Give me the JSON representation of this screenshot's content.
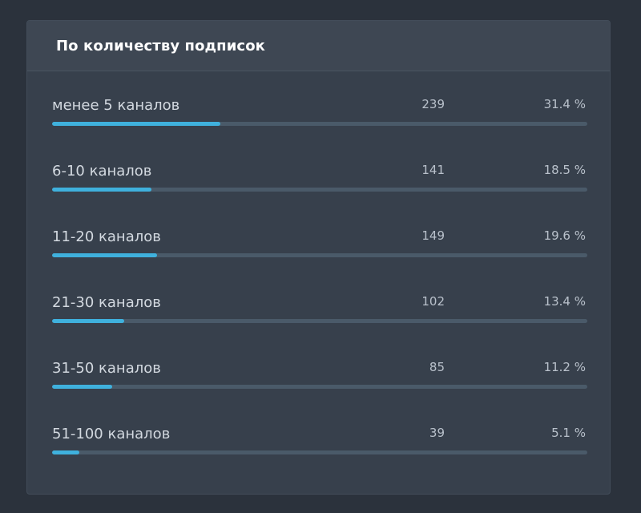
{
  "panel": {
    "title": "По количеству подписок"
  },
  "rows": [
    {
      "label": "менее 5 каналов",
      "count": "239",
      "percent": "31.4 %",
      "fraction": 0.314
    },
    {
      "label": "6-10 каналов",
      "count": "141",
      "percent": "18.5 %",
      "fraction": 0.185
    },
    {
      "label": "11-20 каналов",
      "count": "149",
      "percent": "19.6 %",
      "fraction": 0.196
    },
    {
      "label": "21-30 каналов",
      "count": "102",
      "percent": "13.4 %",
      "fraction": 0.134
    },
    {
      "label": "31-50 каналов",
      "count": "85",
      "percent": "11.2 %",
      "fraction": 0.112
    },
    {
      "label": "51-100 каналов",
      "count": "39",
      "percent": "5.1 %",
      "fraction": 0.051
    }
  ],
  "colors": {
    "background": "#2b323c",
    "card": "#37404c",
    "header": "#3e4753",
    "bar_track": "#4a5a69",
    "bar_fill": "#3fb1dd"
  }
}
